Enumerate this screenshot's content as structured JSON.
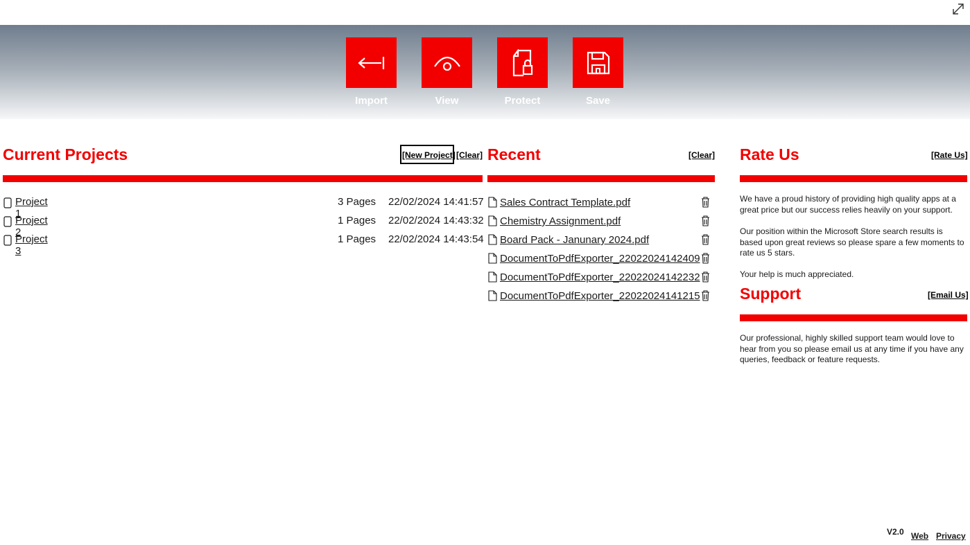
{
  "toolbar": {
    "import_label": "Import",
    "view_label": "View",
    "protect_label": "Protect",
    "save_label": "Save"
  },
  "current_projects": {
    "title": "Current Projects",
    "new_project_label": "[New Project]",
    "clear_label": "[Clear]",
    "items": [
      {
        "name": "Project 1",
        "pages": "3 Pages",
        "date": "22/02/2024 14:41:57"
      },
      {
        "name": "Project 2",
        "pages": "1 Pages",
        "date": "22/02/2024 14:43:32"
      },
      {
        "name": "Project 3",
        "pages": "1 Pages",
        "date": "22/02/2024 14:43:54"
      }
    ]
  },
  "recent": {
    "title": "Recent",
    "clear_label": "[Clear]",
    "items": [
      "Sales Contract Template.pdf",
      "Chemistry Assignment.pdf",
      "Board Pack - Janunary 2024.pdf",
      "DocumentToPdfExporter_22022024142409",
      "DocumentToPdfExporter_22022024142232",
      "DocumentToPdfExporter_22022024141215"
    ]
  },
  "rate_us": {
    "title": "Rate Us",
    "link_label": "[Rate Us]",
    "paragraphs": [
      "We have a proud history of providing high quality apps at a great price but our success relies heavily on your support.",
      "Our position within the Microsoft Store search results is based upon great reviews so please spare a few moments to rate us 5 stars.",
      "Your help is much appreciated."
    ]
  },
  "support": {
    "title": "Support",
    "link_label": "[Email Us]",
    "paragraph": "Our professional, highly skilled support team would love to hear from you so please email us at any time if you have any queries, feedback or feature requests."
  },
  "footer": {
    "version": "V2.0",
    "web_label": "Web",
    "privacy_label": "Privacy"
  },
  "colors": {
    "accent": "#f20000",
    "ribbon_top": "#6f7d8d"
  }
}
